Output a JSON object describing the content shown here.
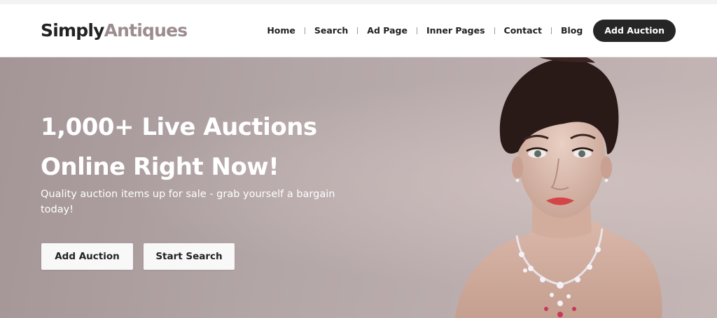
{
  "brand": {
    "part1": "Simply",
    "part2": "Antiques"
  },
  "nav": {
    "items": [
      "Home",
      "Search",
      "Ad Page",
      "Inner Pages",
      "Contact",
      "Blog"
    ],
    "cta": "Add Auction"
  },
  "hero": {
    "title_line1": "1,000+ Live Auctions",
    "title_line2": "Online Right Now!",
    "subtitle": "Quality auction items up for sale - grab yourself a bargain today!",
    "buttons": {
      "add": "Add Auction",
      "search": "Start Search"
    }
  },
  "colors": {
    "brand_dark": "#222222",
    "brand_accent": "#9c8d8e",
    "cta_bg": "#262626",
    "hero_bg": "#b3a6a6"
  }
}
